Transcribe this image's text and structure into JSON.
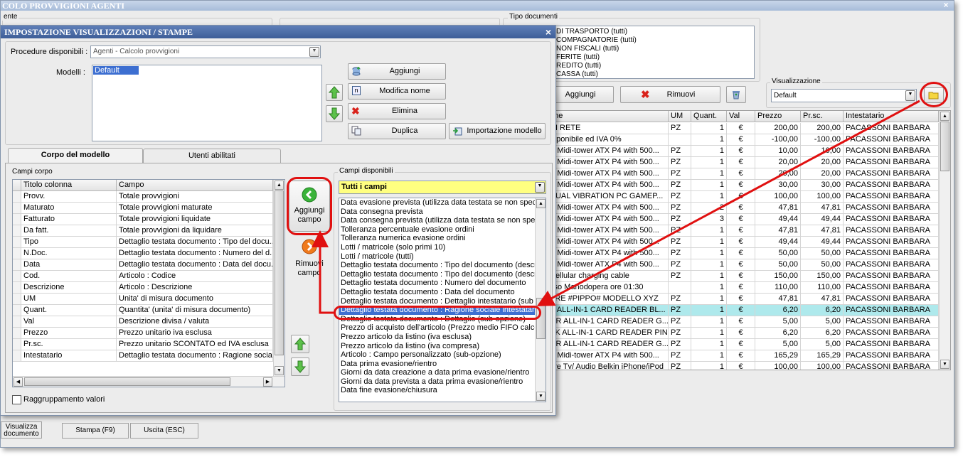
{
  "main": {
    "title": "COLO PROVVIGIONI AGENTI",
    "close_glyph": "×",
    "left_group_label": "ente",
    "tipo_documenti": {
      "label": "Tipo documenti",
      "items": [
        "DI TRASPORTO (tutti)",
        "COMPAGNATORIE (tutti)",
        "NON FISCALI (tutti)",
        "FERITE (tutti)",
        "REDITO (tutti)",
        "CASSA (tutti)"
      ]
    },
    "aggiungi_label": "Aggiungi",
    "rimuovi_label": "Rimuovi",
    "visualizzazione": {
      "label": "Visualizzazione",
      "value": "Default"
    },
    "grid": {
      "columns": [
        "one",
        "UM",
        "Quant.",
        "Val",
        "Prezzo",
        "Pr.sc.",
        "Intestatario"
      ],
      "rows": [
        {
          "desc": "DI RETE",
          "um": "PZ",
          "qty": "1",
          "val": "€",
          "prezzo": "200,00",
          "prsc": "200,00",
          "int": "PACASSONI BARBARA",
          "sel": false
        },
        {
          "desc": "mponibile ed IVA 0%",
          "um": "",
          "qty": "1",
          "val": "€",
          "prezzo": "-100,00",
          "prsc": "-100,00",
          "int": "PACASSONI BARBARA",
          "sel": false
        },
        {
          "desc": "B Midi-tower ATX P4 with 500...",
          "um": "PZ",
          "qty": "1",
          "val": "€",
          "prezzo": "10,00",
          "prsc": "10,00",
          "int": "PACASSONI BARBARA",
          "sel": false
        },
        {
          "desc": "B Midi-tower ATX P4 with 500...",
          "um": "PZ",
          "qty": "1",
          "val": "€",
          "prezzo": "20,00",
          "prsc": "20,00",
          "int": "PACASSONI BARBARA",
          "sel": false
        },
        {
          "desc": "B Midi-tower ATX P4 with 500...",
          "um": "PZ",
          "qty": "1",
          "val": "€",
          "prezzo": "20,00",
          "prsc": "20,00",
          "int": "PACASSONI BARBARA",
          "sel": false
        },
        {
          "desc": "B Midi-tower ATX P4 with 500...",
          "um": "PZ",
          "qty": "1",
          "val": "€",
          "prezzo": "30,00",
          "prsc": "30,00",
          "int": "PACASSONI BARBARA",
          "sel": false
        },
        {
          "desc": "DUAL VIBRATION PC GAMEP...",
          "um": "PZ",
          "qty": "1",
          "val": "€",
          "prezzo": "100,00",
          "prsc": "100,00",
          "int": "PACASSONI BARBARA",
          "sel": false
        },
        {
          "desc": "B Midi-tower ATX P4 with 500...",
          "um": "PZ",
          "qty": "2",
          "val": "€",
          "prezzo": "47,81",
          "prsc": "47,81",
          "int": "PACASSONI BARBARA",
          "sel": false
        },
        {
          "desc": "B Midi-tower ATX P4 with 500...",
          "um": "PZ",
          "qty": "3",
          "val": "€",
          "prezzo": "49,44",
          "prsc": "49,44",
          "int": "PACASSONI BARBARA",
          "sel": false
        },
        {
          "desc": "B Midi-tower ATX P4 with 500...",
          "um": "PZ",
          "qty": "1",
          "val": "€",
          "prezzo": "47,81",
          "prsc": "47,81",
          "int": "PACASSONI BARBARA",
          "sel": false
        },
        {
          "desc": "B Midi-tower ATX P4 with 500...",
          "um": "PZ",
          "qty": "1",
          "val": "€",
          "prezzo": "49,44",
          "prsc": "49,44",
          "int": "PACASSONI BARBARA",
          "sel": false
        },
        {
          "desc": "B Midi-tower ATX P4 with 500...",
          "um": "PZ",
          "qty": "1",
          "val": "€",
          "prezzo": "50,00",
          "prsc": "50,00",
          "int": "PACASSONI BARBARA",
          "sel": false
        },
        {
          "desc": "B Midi-tower ATX P4 with 500...",
          "um": "PZ",
          "qty": "1",
          "val": "€",
          "prezzo": "50,00",
          "prsc": "50,00",
          "int": "PACASSONI BARBARA",
          "sel": false
        },
        {
          "desc": "Cellular charging cable",
          "um": "PZ",
          "qty": "1",
          "val": "€",
          "prezzo": "150,00",
          "prsc": "150,00",
          "int": "PACASSONI BARBARA",
          "sel": false
        },
        {
          "desc": "sso Manodopera ore 01:30",
          "um": "",
          "qty": "1",
          "val": "€",
          "prezzo": "110,00",
          "prsc": "110,00",
          "int": "PACASSONI BARBARA",
          "sel": false
        },
        {
          "desc": "ARE #PIPPO# MODELLO XYZ",
          "um": "PZ",
          "qty": "1",
          "val": "€",
          "prezzo": "47,81",
          "prsc": "47,81",
          "int": "PACASSONI BARBARA",
          "sel": false
        },
        {
          "desc": "K ALL-IN-1 CARD READER BL...",
          "um": "PZ",
          "qty": "1",
          "val": "€",
          "prezzo": "6,20",
          "prsc": "6,20",
          "int": "PACASSONI BARBARA",
          "sel": true
        },
        {
          "desc": "GR ALL-IN-1 CARD READER G...",
          "um": "PZ",
          "qty": "1",
          "val": "€",
          "prezzo": "5,00",
          "prsc": "5,00",
          "int": "PACASSONI BARBARA",
          "sel": false
        },
        {
          "desc": "PK ALL-IN-1 CARD READER PINK",
          "um": "PZ",
          "qty": "1",
          "val": "€",
          "prezzo": "6,20",
          "prsc": "6,20",
          "int": "PACASSONI BARBARA",
          "sel": false
        },
        {
          "desc": "GR ALL-IN-1 CARD READER G...",
          "um": "PZ",
          "qty": "1",
          "val": "€",
          "prezzo": "5,00",
          "prsc": "5,00",
          "int": "PACASSONI BARBARA",
          "sel": false
        },
        {
          "desc": "B Midi-tower ATX P4 with 500...",
          "um": "PZ",
          "qty": "1",
          "val": "€",
          "prezzo": "165,29",
          "prsc": "165,29",
          "int": "PACASSONI BARBARA",
          "sel": false
        },
        {
          "desc": "ore Tv/ Audio Belkin iPhone/iPod",
          "um": "PZ",
          "qty": "1",
          "val": "€",
          "prezzo": "100,00",
          "prsc": "100,00",
          "int": "PACASSONI BARBARA",
          "sel": false
        }
      ]
    },
    "bottom_buttons": [
      "Visualizza documento",
      "Stampa (F9)",
      "Uscita (ESC)"
    ]
  },
  "dialog": {
    "title": "IMPOSTAZIONE VISUALIZZAZIONI / STAMPE",
    "close_glyph": "×",
    "procedure_label": "Procedure disponibili :",
    "procedure_value": "Agenti - Calcolo provvigioni",
    "modelli_label": "Modelli :",
    "modelli_items": [
      "Default"
    ],
    "buttons": {
      "aggiungi": "Aggiungi",
      "modifica_nome": "Modifica nome",
      "elimina": "Elimina",
      "duplica": "Duplica",
      "importazione": "Importazione modello"
    },
    "tabs": [
      "Corpo del modello",
      "Utenti abilitati"
    ],
    "campi_corpo_label": "Campi corpo",
    "corpo_columns": [
      "Titolo colonna",
      "Campo"
    ],
    "corpo_rows": [
      [
        "Provv.",
        "Totale provvigioni"
      ],
      [
        "Maturato",
        "Totale provvigioni maturate"
      ],
      [
        "Fatturato",
        "Totale provvigioni liquidate"
      ],
      [
        "Da fatt.",
        "Totale provvigioni da liquidare"
      ],
      [
        "Tipo",
        "Dettaglio testata documento : Tipo del docu..."
      ],
      [
        "N.Doc.",
        "Dettaglio testata documento : Numero del d..."
      ],
      [
        "Data",
        "Dettaglio testata documento : Data del docu..."
      ],
      [
        "Cod.",
        "Articolo : Codice"
      ],
      [
        "Descrizione",
        "Articolo : Descrizione"
      ],
      [
        "UM",
        "Unita' di misura documento"
      ],
      [
        "Quant.",
        "Quantita' (unita' di misura documento)"
      ],
      [
        "Val",
        "Descrizione divisa / valuta"
      ],
      [
        "Prezzo",
        "Prezzo unitario iva esclusa"
      ],
      [
        "Pr.sc.",
        "Prezzo unitario SCONTATO ed IVA esclusa"
      ],
      [
        "Intestatario",
        "Dettaglio testata documento : Ragione socia..."
      ]
    ],
    "aggiungi_campo": "Aggiungi campo",
    "rimuovi_campo": "Rimuovi campo",
    "raggruppamento": "Raggruppamento valori",
    "campi_disponibili_label": "Campi disponibili",
    "filter_value": "Tutti i campi",
    "available_fields": [
      "Data evasione prevista (utilizza data testata se non spec",
      "Data consegna prevista",
      "Data consegna prevista (utilizza data testata se non spec",
      "Tolleranza percentuale evasione ordini",
      "Tolleranza numerica evasione ordini",
      "Lotti / matricole (solo primi 10)",
      "Lotti / matricole (tutti)",
      "Dettaglio testata documento : Tipo del documento (descr",
      "Dettaglio testata documento : Tipo del documento (descr",
      "Dettaglio testata documento : Numero del documento",
      "Dettaglio testata documento : Data del documento",
      "Dettaglio testata documento : Dettaglio intestatario (sub",
      "Dettaglio testata documento : Ragione sociale intestatario",
      "Dettaglio testata documento : Dettaglio (sub-opzione)",
      "Prezzo di acquisto dell'articolo (Prezzo medio FIFO calcola",
      "Prezzo articolo da listino (iva esclusa)",
      "Prezzo articolo da listino (iva compresa)",
      "Articolo : Campo personalizzato (sub-opzione)",
      "Data prima evasione/rientro",
      "Giorni da data creazione a data prima evasione/rientro",
      "Giorni da data prevista a data prima evasione/rientro",
      "Data fine evasione/chiusura"
    ],
    "selected_field_index": 12
  }
}
